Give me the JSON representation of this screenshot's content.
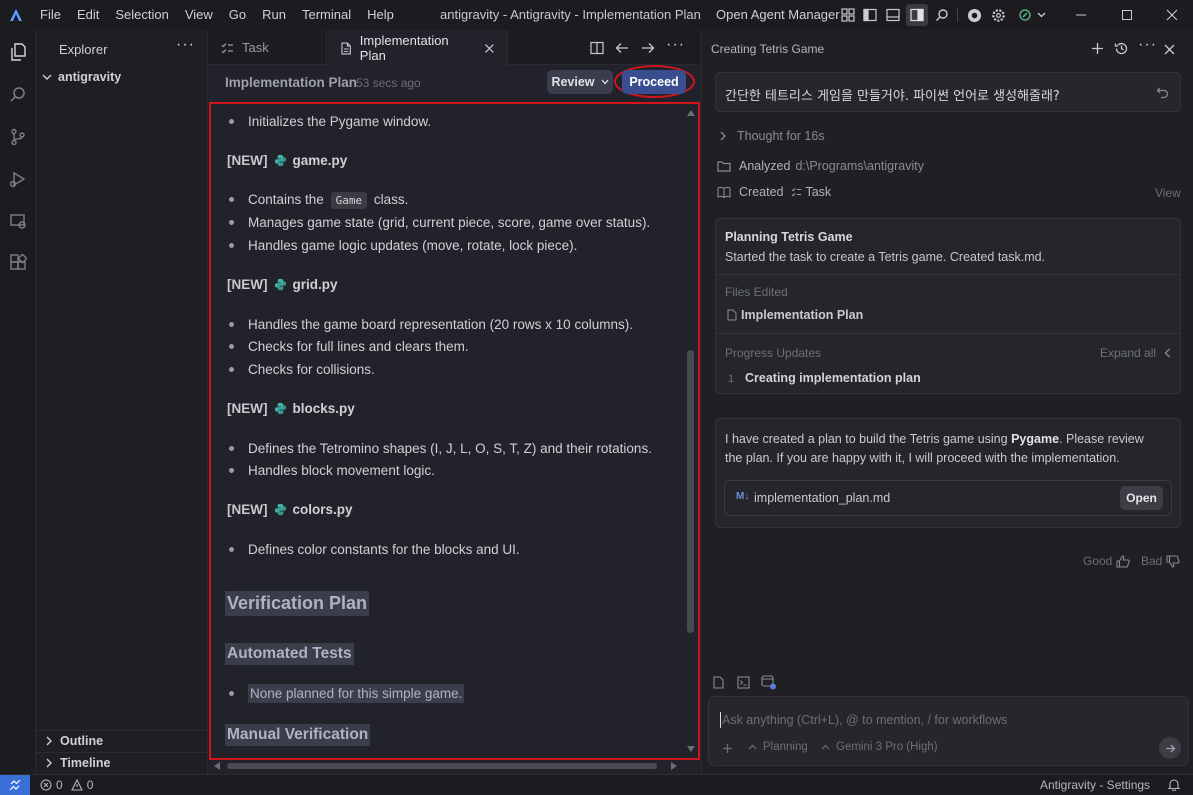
{
  "titlebar": {
    "menu": [
      "File",
      "Edit",
      "Selection",
      "View",
      "Go",
      "Run",
      "Terminal",
      "Help"
    ],
    "window_title": "antigravity - Antigravity - Implementation Plan",
    "open_agent_manager": "Open Agent Manager"
  },
  "sidebar": {
    "title": "Explorer",
    "folder": "antigravity",
    "outline": "Outline",
    "timeline": "Timeline"
  },
  "editor": {
    "tabs": [
      {
        "label": "Task",
        "active": false
      },
      {
        "label": "Implementation Plan",
        "active": true
      }
    ],
    "doc_title": "Implementation Plan",
    "doc_time": "53 secs ago",
    "review_label": "Review",
    "proceed_label": "Proceed",
    "content": {
      "intro_bullet": "Initializes the Pygame window.",
      "files": [
        {
          "tag": "[NEW]",
          "name": "game.py"
        },
        {
          "tag": "[NEW]",
          "name": "grid.py"
        },
        {
          "tag": "[NEW]",
          "name": "blocks.py"
        },
        {
          "tag": "[NEW]",
          "name": "colors.py"
        }
      ],
      "game_bullets": {
        "contains_pre": "Contains the",
        "code": "Game",
        "contains_post": "class."
      },
      "game_bullets_2": [
        "Manages game state (grid, current piece, score, game over status).",
        "Handles game logic updates (move, rotate, lock piece)."
      ],
      "grid_bullets": [
        "Handles the game board representation (20 rows x 10 columns).",
        "Checks for full lines and clears them.",
        "Checks for collisions."
      ],
      "blocks_bullets": [
        "Defines the Tetromino shapes (I, J, L, O, S, T, Z) and their rotations.",
        "Handles block movement logic."
      ],
      "colors_bullets": [
        "Defines color constants for the blocks and UI."
      ],
      "verification_plan": "Verification Plan",
      "automated_tests": "Automated Tests",
      "automated_bullet": "None planned for this simple game.",
      "manual_verification": "Manual Verification"
    }
  },
  "chat": {
    "header_title": "Creating Tetris Game",
    "user_message": "간단한 테트리스 게임을 만들거야. 파이썬 언어로 생성해줄래?",
    "thought": "Thought for 16s",
    "analyzed_label": "Analyzed",
    "analyzed_path": "d:\\Programs\\antigravity",
    "created_label": "Created",
    "created_item": "Task",
    "view_label": "View",
    "planning_card": {
      "title": "Planning Tetris Game",
      "desc": "Started the task to create a Tetris game. Created task.md.",
      "files_edited_label": "Files Edited",
      "file": "Implementation Plan",
      "progress_label": "Progress Updates",
      "expand_all": "Expand all",
      "step_num": "1",
      "step_text": "Creating implementation plan"
    },
    "message": {
      "line1_pre": "I have created a plan to build the Tetris game using",
      "line1_bold": "Pygame",
      "line1_post": ". Please review",
      "line2": "the plan. If you are happy with it, I will proceed with the implementation.",
      "file": "implementation_plan.md",
      "open_label": "Open"
    },
    "feedback": {
      "good": "Good",
      "bad": "Bad"
    },
    "input_placeholder": "Ask anything (Ctrl+L), @ to mention, / for workflows",
    "mode": "Planning",
    "model": "Gemini 3 Pro (High)"
  },
  "statusbar": {
    "errors": "0",
    "warnings": "0",
    "settings": "Antigravity - Settings"
  },
  "colors": {
    "accent_red": "#d0161c",
    "proceed_bg": "#3a4d8f",
    "python_icon": "#3fb6a8"
  }
}
